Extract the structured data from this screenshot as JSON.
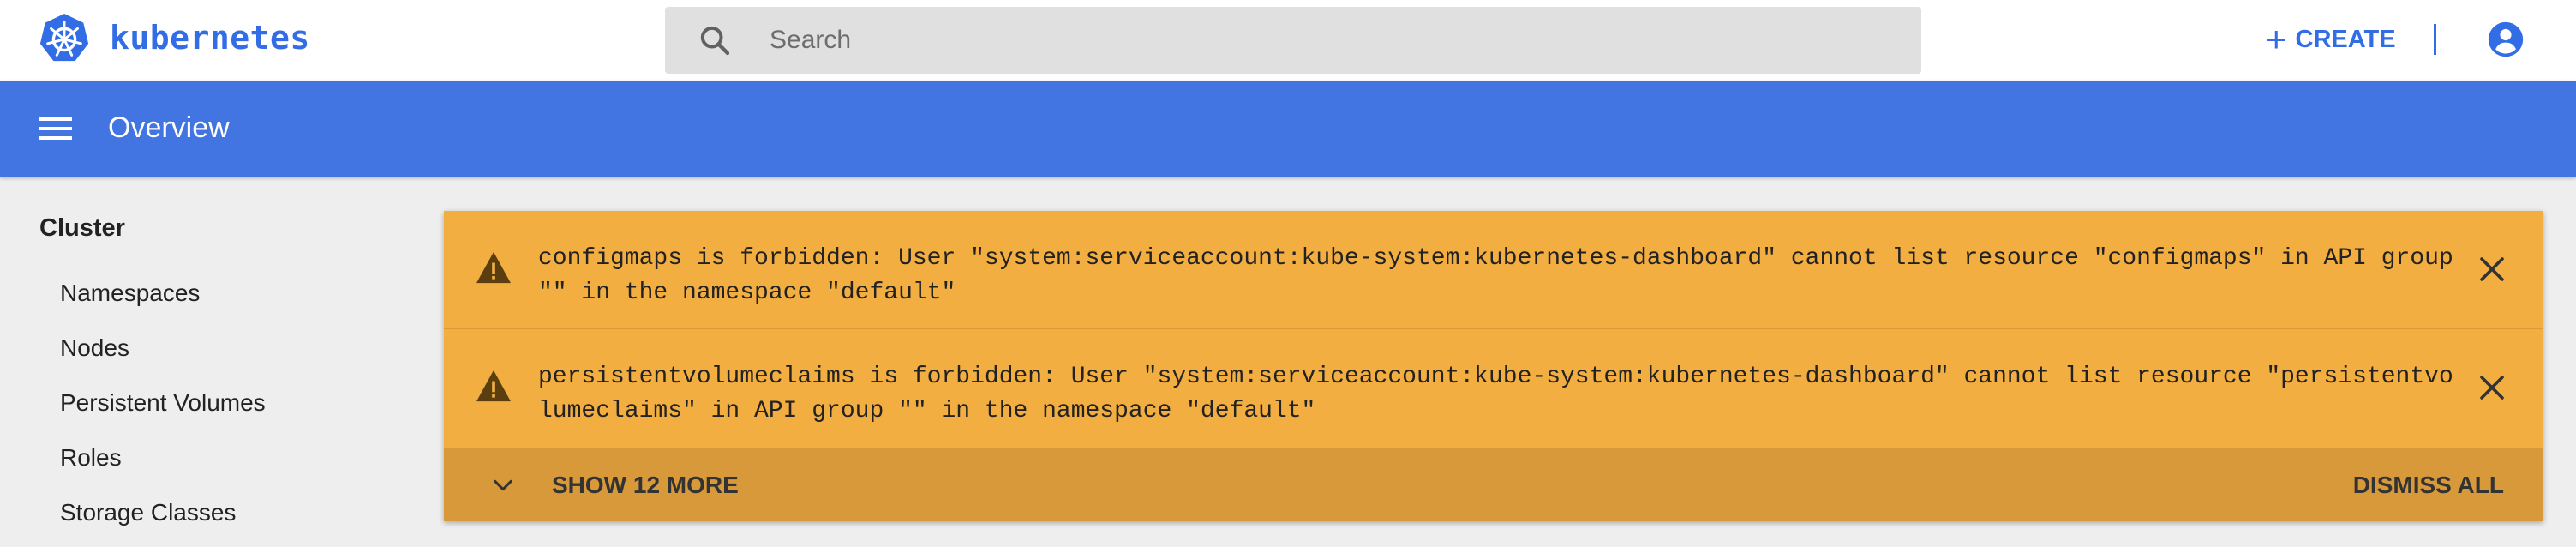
{
  "header": {
    "brand": "kubernetes",
    "search_placeholder": "Search",
    "create_label": "CREATE",
    "colors": {
      "brand": "#326de6",
      "titlebar": "#4274e2"
    }
  },
  "titlebar": {
    "title": "Overview"
  },
  "sidebar": {
    "heading": "Cluster",
    "items": [
      {
        "label": "Namespaces"
      },
      {
        "label": "Nodes"
      },
      {
        "label": "Persistent Volumes"
      },
      {
        "label": "Roles"
      },
      {
        "label": "Storage Classes"
      }
    ]
  },
  "alerts": {
    "colors": {
      "alert": "#f3ae42",
      "footer": "#d8993a"
    },
    "items": [
      {
        "icon": "warning-icon",
        "text": "configmaps is forbidden: User \"system:serviceaccount:kube-system:kubernetes-dashboard\" cannot list resource \"configmaps\" in API group \"\" in the namespace \"default\""
      },
      {
        "icon": "warning-icon",
        "text": "persistentvolumeclaims is forbidden: User \"system:serviceaccount:kube-system:kubernetes-dashboard\" cannot list resource \"persistentvolumeclaims\" in API group \"\" in the namespace \"default\""
      }
    ],
    "show_more_label": "SHOW 12 MORE",
    "dismiss_all_label": "DISMISS ALL"
  }
}
